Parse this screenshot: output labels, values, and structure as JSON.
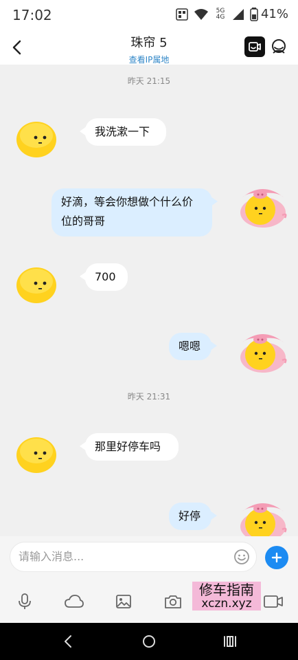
{
  "status_bar": {
    "time": "17:02",
    "network": "5G\n4G",
    "battery": "41%"
  },
  "header": {
    "title": "珠帘 5",
    "ip_link": "查看IP属地",
    "video_icon": "video-call-icon",
    "profile_icon": "profile-icon"
  },
  "chat": {
    "time_labels": [
      "昨天 21:15",
      "昨天 21:31"
    ],
    "messages": [
      {
        "side": "in",
        "text": "我洗漱一下"
      },
      {
        "side": "out",
        "text": "好滴，等会你想做个什么价位的哥哥"
      },
      {
        "side": "in",
        "text": "700"
      },
      {
        "side": "out",
        "text": "嗯嗯"
      },
      {
        "side": "in",
        "text": "那里好停车吗"
      },
      {
        "side": "out",
        "text": "好停"
      }
    ]
  },
  "input": {
    "placeholder": "请输入消息..."
  },
  "toolbar": {
    "items": [
      "microphone-icon",
      "cloud-icon",
      "image-icon",
      "camera-icon",
      "gif-icon"
    ]
  },
  "watermark": {
    "line1": "修车指南",
    "line2": "xczn.xyz"
  },
  "colors": {
    "accent": "#1c8bf2",
    "outgoing_bubble": "#dbeeff",
    "incoming_bubble": "#ffffff",
    "chat_bg": "#f0f0f0"
  }
}
